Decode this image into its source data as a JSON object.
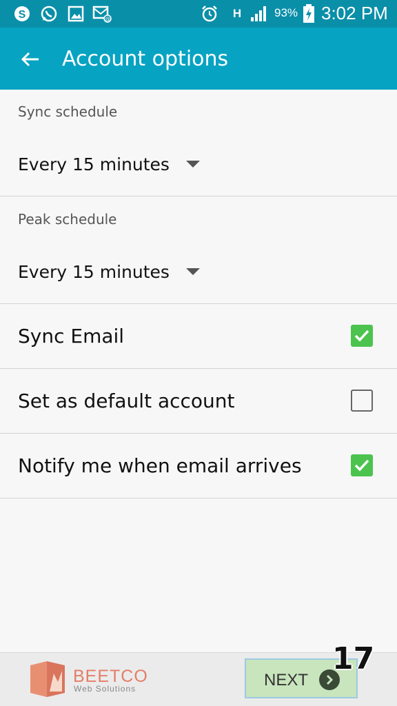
{
  "status_bar": {
    "icons": [
      "skype-icon",
      "whatsapp-icon",
      "gallery-icon",
      "email-icon",
      "alarm-icon",
      "hspa-icon",
      "signal-icon",
      "battery-icon"
    ],
    "network_label": "H",
    "battery_percent": "93%",
    "time": "3:02 PM"
  },
  "app_bar": {
    "title": "Account options",
    "back_icon": "arrow-left-icon",
    "background": "#07a3c3"
  },
  "sync_schedule": {
    "label": "Sync schedule",
    "value": "Every 15 minutes"
  },
  "peak_schedule": {
    "label": "Peak schedule",
    "value": "Every 15 minutes"
  },
  "options": [
    {
      "label": "Sync Email",
      "checked": true
    },
    {
      "label": "Set as default account",
      "checked": false
    },
    {
      "label": "Notify me when email arrives",
      "checked": true
    }
  ],
  "footer": {
    "brand": "BEETCO",
    "tagline": "Web Solutions",
    "next_label": "NEXT",
    "step": "17"
  },
  "colors": {
    "checkbox_checked": "#4cc34f",
    "status_bar": "#0a8fa9",
    "brand": "#e57d67"
  }
}
